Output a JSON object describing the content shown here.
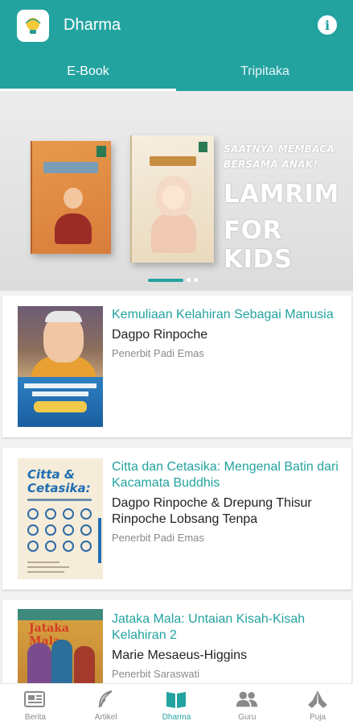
{
  "appbar": {
    "title": "Dharma",
    "logo_icon": "lamp-logo-icon",
    "info_icon": "info-icon",
    "info_glyph": "i"
  },
  "tabs": [
    {
      "label": "E-Book",
      "active": true
    },
    {
      "label": "Tripitaka",
      "active": false
    }
  ],
  "banner": {
    "subtitle_line1": "SAATNYA MEMBACA",
    "subtitle_line2": "BERSAMA ANAK!",
    "headline_line1": "LAMRIM",
    "headline_line2": "FOR KIDS",
    "slide_count": 3,
    "active_slide": 1
  },
  "books": [
    {
      "title": "Kemuliaan Kelahiran Sebagai Manusia",
      "author": "Dagpo Rinpoche",
      "publisher": "Penerbit Padi Emas",
      "cover_text": "Manusia"
    },
    {
      "title": "Citta dan Cetasika: Mengenal Batin dari Kacamata Buddhis",
      "author": "Dagpo Rinpoche & Drepung Thisur Rinpoche Lobsang Tenpa",
      "publisher": "Penerbit Padi Emas",
      "cover_text": "Citta & Cetasika:"
    },
    {
      "title": "Jataka Mala: Untaian Kisah-Kisah Kelahiran 2",
      "author": "Marie Mesaeus-Higgins",
      "publisher": "Penerbit Saraswati",
      "cover_text": "Jataka Mala"
    }
  ],
  "bottom_nav": [
    {
      "label": "Berita",
      "icon": "newspaper-icon",
      "active": false
    },
    {
      "label": "Artikel",
      "icon": "feather-icon",
      "active": false
    },
    {
      "label": "Dharma",
      "icon": "open-book-icon",
      "active": true
    },
    {
      "label": "Guru",
      "icon": "people-icon",
      "active": false
    },
    {
      "label": "Puja",
      "icon": "praying-hands-icon",
      "active": false
    }
  ],
  "colors": {
    "primary": "#23a3a0",
    "inactive": "#8a8a8a"
  }
}
